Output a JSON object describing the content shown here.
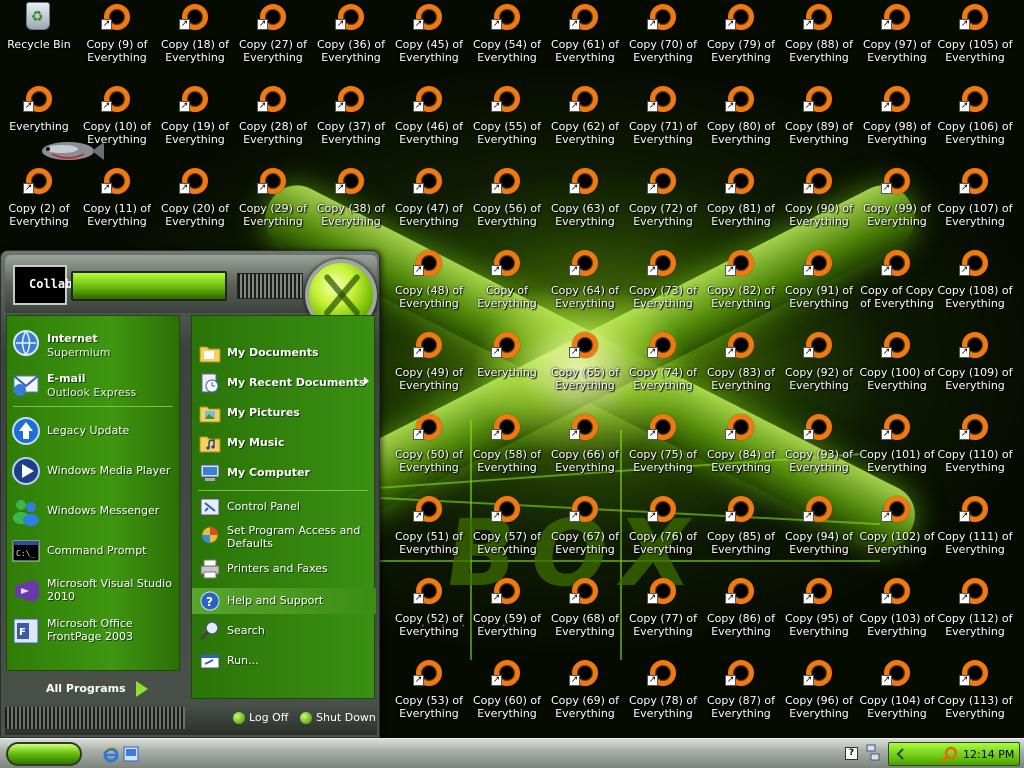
{
  "desktop": {
    "recycle_bin": "Recycle Bin",
    "icons": [
      {
        "label": "Copy (9) of Everything"
      },
      {
        "label": "Copy (18) of Everything"
      },
      {
        "label": "Copy (27) of Everything"
      },
      {
        "label": "Copy (36) of Everything"
      },
      {
        "label": "Copy (45) of Everything"
      },
      {
        "label": "Copy (54) of Everything"
      },
      {
        "label": "Copy (61) of Everything"
      },
      {
        "label": "Copy (70) of Everything"
      },
      {
        "label": "Copy (79) of Everything"
      },
      {
        "label": "Copy (88) of Everything"
      },
      {
        "label": "Copy (97) of Everything"
      },
      {
        "label": "Copy (105) of Everything"
      },
      {
        "label": "Everything"
      },
      {
        "label": "Copy (10) of Everything"
      },
      {
        "label": "Copy (19) of Everything"
      },
      {
        "label": "Copy (28) of Everything"
      },
      {
        "label": "Copy (37) of Everything"
      },
      {
        "label": "Copy (46) of Everything"
      },
      {
        "label": "Copy (55) of Everything"
      },
      {
        "label": "Copy (62) of Everything"
      },
      {
        "label": "Copy (71) of Everything"
      },
      {
        "label": "Copy (80) of Everything"
      },
      {
        "label": "Copy (89) of Everything"
      },
      {
        "label": "Copy (98) of Everything"
      },
      {
        "label": "Copy (106) of Everything"
      },
      {
        "label": "Copy (2) of Everything"
      },
      {
        "label": "Copy (11) of Everything"
      },
      {
        "label": "Copy (20) of Everything"
      },
      {
        "label": "Copy (29) of Everything"
      },
      {
        "label": "Copy (38) of Everything"
      },
      {
        "label": "Copy (47) of Everything"
      },
      {
        "label": "Copy (56) of Everything"
      },
      {
        "label": "Copy (63) of Everything"
      },
      {
        "label": "Copy (72) of Everything"
      },
      {
        "label": "Copy (81) of Everything"
      },
      {
        "label": "Copy (90) of Everything"
      },
      {
        "label": "Copy (99) of Everything"
      },
      {
        "label": "Copy (107) of Everything"
      },
      {
        "label": "Copy (48) of Everything"
      },
      {
        "label": "Copy of Everything"
      },
      {
        "label": "Copy (64) of Everything"
      },
      {
        "label": "Copy (73) of Everything"
      },
      {
        "label": "Copy (82) of Everything"
      },
      {
        "label": "Copy (91) of Everything"
      },
      {
        "label": "Copy of Copy of Everything"
      },
      {
        "label": "Copy (108) of Everything"
      },
      {
        "label": "Copy (49) of Everything"
      },
      {
        "label": "Everything"
      },
      {
        "label": "Copy (65) of Everything"
      },
      {
        "label": "Copy (74) of Everything"
      },
      {
        "label": "Copy (83) of Everything"
      },
      {
        "label": "Copy (92) of Everything"
      },
      {
        "label": "Copy (100) of Everything"
      },
      {
        "label": "Copy (109) of Everything"
      },
      {
        "label": "Copy (50) of Everything"
      },
      {
        "label": "Copy (58) of Everything"
      },
      {
        "label": "Copy (66) of Everything"
      },
      {
        "label": "Copy (75) of Everything"
      },
      {
        "label": "Copy (84) of Everything"
      },
      {
        "label": "Copy (93) of Everything"
      },
      {
        "label": "Copy (101) of Everything"
      },
      {
        "label": "Copy (110) of Everything"
      },
      {
        "label": "Copy (51) of Everything"
      },
      {
        "label": "Copy (57) of Everything"
      },
      {
        "label": "Copy (67) of Everything"
      },
      {
        "label": "Copy (76) of Everything"
      },
      {
        "label": "Copy (85) of Everything"
      },
      {
        "label": "Copy (94) of Everything"
      },
      {
        "label": "Copy (102) of Everything"
      },
      {
        "label": "Copy (111) of Everything"
      },
      {
        "label": "Copy (52) of Everything"
      },
      {
        "label": "Copy (59) of Everything"
      },
      {
        "label": "Copy (68) of Everything"
      },
      {
        "label": "Copy (77) of Everything"
      },
      {
        "label": "Copy (86) of Everything"
      },
      {
        "label": "Copy (95) of Everything"
      },
      {
        "label": "Copy (103) of Everything"
      },
      {
        "label": "Copy (112) of Everything"
      },
      {
        "label": "Copy (53) of Everything"
      },
      {
        "label": "Copy (60) of Everything"
      },
      {
        "label": "Copy (69) of Everything"
      },
      {
        "label": "Copy (78) of Everything"
      },
      {
        "label": "Copy (87) of Everything"
      },
      {
        "label": "Copy (96) of Everything"
      },
      {
        "label": "Copy (104) of Everything"
      },
      {
        "label": "Copy (113) of Everything"
      }
    ]
  },
  "start_menu": {
    "username": "CollabVM",
    "pinned": [
      {
        "title": "Internet",
        "subtitle": "Supermium",
        "icon": "globe-icon"
      },
      {
        "title": "E-mail",
        "subtitle": "Outlook Express",
        "icon": "mail-icon"
      }
    ],
    "recent": [
      {
        "label": "Legacy Update",
        "icon": "update-icon"
      },
      {
        "label": "Windows Media Player",
        "icon": "media-player-icon"
      },
      {
        "label": "Windows Messenger",
        "icon": "messenger-icon"
      },
      {
        "label": "Command Prompt",
        "icon": "terminal-icon"
      },
      {
        "label": "Microsoft Visual Studio 2010",
        "icon": "visual-studio-icon"
      },
      {
        "label": "Microsoft Office FrontPage 2003",
        "icon": "frontpage-icon"
      }
    ],
    "all_programs": "All Programs",
    "places": [
      {
        "label": "My Documents",
        "icon": "folder-icon"
      },
      {
        "label": "My Recent Documents",
        "icon": "recent-docs-icon"
      },
      {
        "label": "My Pictures",
        "icon": "pictures-folder-icon"
      },
      {
        "label": "My Music",
        "icon": "music-folder-icon"
      },
      {
        "label": "My Computer",
        "icon": "computer-icon"
      }
    ],
    "system": [
      {
        "label": "Control Panel",
        "icon": "control-panel-icon"
      },
      {
        "label": "Set Program Access and Defaults",
        "icon": "program-defaults-icon"
      },
      {
        "label": "Printers and Faxes",
        "icon": "printer-icon"
      },
      {
        "label": "Help and Support",
        "icon": "help-icon"
      },
      {
        "label": "Search",
        "icon": "search-icon"
      },
      {
        "label": "Run...",
        "icon": "run-icon"
      }
    ],
    "log_off": "Log Off",
    "shut_down": "Shut Down"
  },
  "taskbar": {
    "clock": "12:14 PM"
  },
  "wallpaper": {
    "brand": "BOX"
  },
  "colors": {
    "accent": "#6cc014",
    "icon_ring": "#f07a10",
    "menu_green": "#3a9012"
  }
}
